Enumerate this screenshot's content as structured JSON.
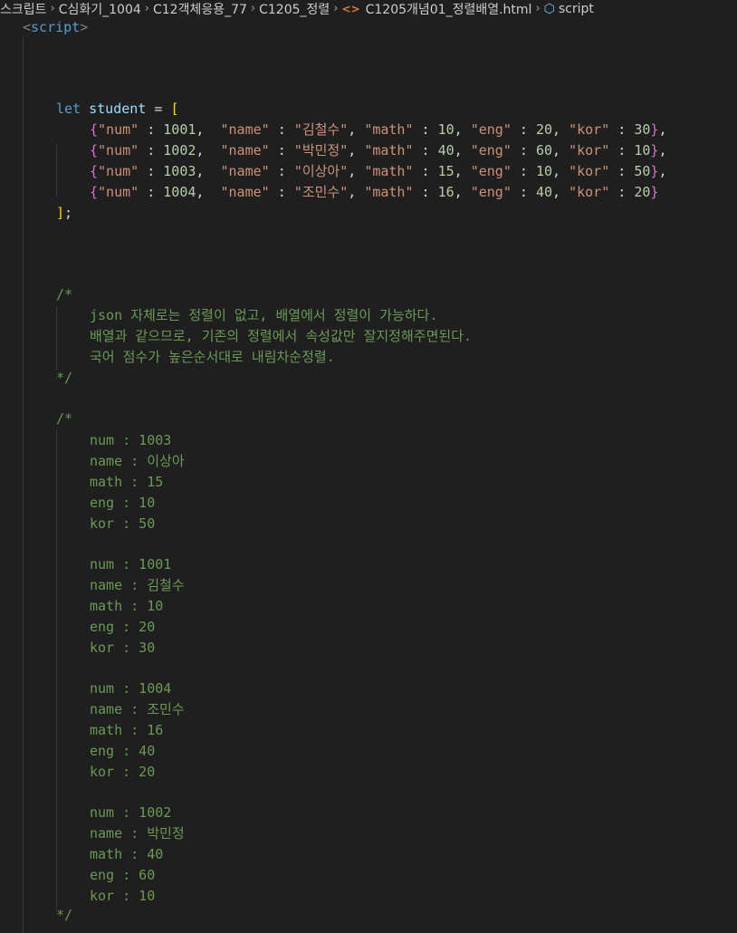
{
  "breadcrumb": {
    "items": [
      "스크립트",
      "C심화기_1004",
      "C12객체응용_77",
      "C1205_정렬",
      "C1205개념01_정렬배열.html",
      "script"
    ]
  },
  "code": {
    "script_tag": "script",
    "decl": {
      "keyword": "let",
      "name": "student"
    },
    "students": [
      {
        "num": "1001",
        "name": "김철수",
        "math": "10",
        "eng": "20",
        "kor": "30"
      },
      {
        "num": "1002",
        "name": "박민정",
        "math": "40",
        "eng": "60",
        "kor": "10"
      },
      {
        "num": "1003",
        "name": "이상아",
        "math": "15",
        "eng": "10",
        "kor": "50"
      },
      {
        "num": "1004",
        "name": "조민수",
        "math": "16",
        "eng": "40",
        "kor": "20"
      }
    ],
    "keys": {
      "num": "\"num\"",
      "name": "\"name\"",
      "math": "\"math\"",
      "eng": "\"eng\"",
      "kor": "\"kor\""
    },
    "comment1": [
      "json 자체로는 정렬이 없고, 배열에서 정렬이 가능하다.",
      "배열과 같으므로, 기존의 정렬에서 속성값만 잘지정해주면된다.",
      "국어 점수가 높은순서대로 내림차순정렬."
    ],
    "sorted": [
      {
        "num": "num : 1003",
        "name": "name : 이상아",
        "math": "math : 15",
        "eng": "eng : 10",
        "kor": "kor : 50"
      },
      {
        "num": "num : 1001",
        "name": "name : 김철수",
        "math": "math : 10",
        "eng": "eng : 20",
        "kor": "kor : 30"
      },
      {
        "num": "num : 1004",
        "name": "name : 조민수",
        "math": "math : 16",
        "eng": "eng : 40",
        "kor": "kor : 20"
      },
      {
        "num": "num : 1002",
        "name": "name : 박민정",
        "math": "math : 40",
        "eng": "eng : 60",
        "kor": "kor : 10"
      }
    ]
  },
  "colors": {
    "background": "#1f1f1f",
    "keyword": "#569cd6",
    "variable": "#9cdcfe",
    "string": "#ce9178",
    "number": "#b5cea8",
    "comment": "#6a9955",
    "bracket_outer": "#ffd700",
    "bracket_inner": "#da70d6"
  },
  "icons": {
    "file": "html-file-icon",
    "symbol": "cube-symbol-icon"
  }
}
